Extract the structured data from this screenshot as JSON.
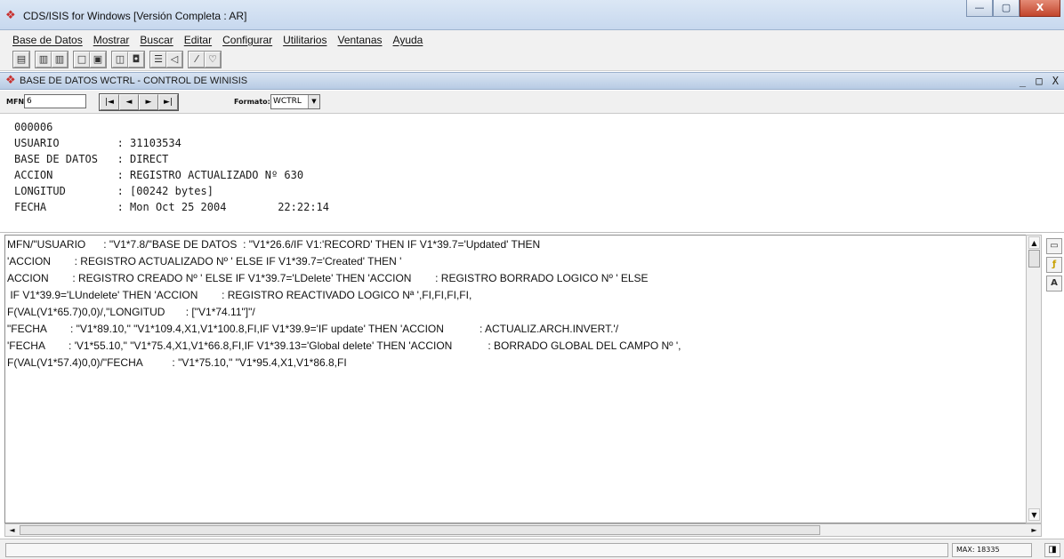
{
  "window": {
    "title": "CDS/ISIS for Windows [Versión Completa : AR]",
    "controls": {
      "minimize": "—",
      "maximize": "▢",
      "close": "X"
    }
  },
  "menu": [
    "Base de Datos",
    "Mostrar",
    "Buscar",
    "Editar",
    "Configurar",
    "Utilitarios",
    "Ventanas",
    "Ayuda"
  ],
  "toolbar": {
    "icons": [
      "open-database-icon",
      "records-icon",
      "records-alt-icon",
      "search-icon",
      "search-results-icon",
      "document-icon",
      "print-icon",
      "edit-form-icon",
      "export-icon",
      "pencil-icon",
      "help-bulb-icon"
    ]
  },
  "database_window": {
    "title": "BASE DE DATOS WCTRL - CONTROL DE WINISIS",
    "controls": "_ □ X",
    "mfn_label": "MFN",
    "mfn_value": "6",
    "formato_label": "Formato:",
    "formato_value": "WCTRL",
    "nav_buttons": [
      "|◄",
      "◄",
      "►",
      "►|"
    ]
  },
  "record": {
    "lines": [
      "000006",
      "USUARIO         : 31103534",
      "BASE DE DATOS   : DIRECT",
      "ACCION          : REGISTRO ACTUALIZADO Nº 630",
      "LONGITUD        : [00242 bytes]",
      "FECHA           : Mon Oct 25 2004        22:22:14"
    ]
  },
  "format_editor": {
    "lines": [
      "MFN/\"USUARIO      : \"V1*7.8/\"BASE DE DATOS  : \"V1*26.6/IF V1:'RECORD' THEN IF V1*39.7='Updated' THEN",
      "'ACCION        : REGISTRO ACTUALIZADO Nº ' ELSE IF V1*39.7='Created' THEN '",
      "ACCION        : REGISTRO CREADO Nº ' ELSE IF V1*39.7='LDelete' THEN 'ACCION        : REGISTRO BORRADO LOGICO Nº ' ELSE",
      " IF V1*39.9='LUndelete' THEN 'ACCION        : REGISTRO REACTIVADO LOGICO Nª ',FI,FI,FI,FI,",
      "F(VAL(V1*65.7)0,0)/,\"LONGITUD       : [\"V1*74.11\"]\"/",
      "\"FECHA        : \"V1*89.10,\" \"V1*109.4,X1,V1*100.8,FI,IF V1*39.9='IF update' THEN 'ACCION            : ACTUALIZ.ARCH.INVERT.'/",
      "'FECHA        : 'V1*55.10,\" \"V1*75.4,X1,V1*66.8,FI,IF V1*39.13='Global delete' THEN 'ACCION            : BORRADO GLOBAL DEL CAMPO Nº ',",
      "F(VAL(V1*57.4)0,0)/\"FECHA          : \"V1*75.10,\" \"V1*95.4,X1,V1*86.8,FI"
    ],
    "side_buttons": [
      "save-icon",
      "format-icon",
      "font-icon"
    ]
  },
  "status": {
    "max_label": "MAX: 18335"
  }
}
